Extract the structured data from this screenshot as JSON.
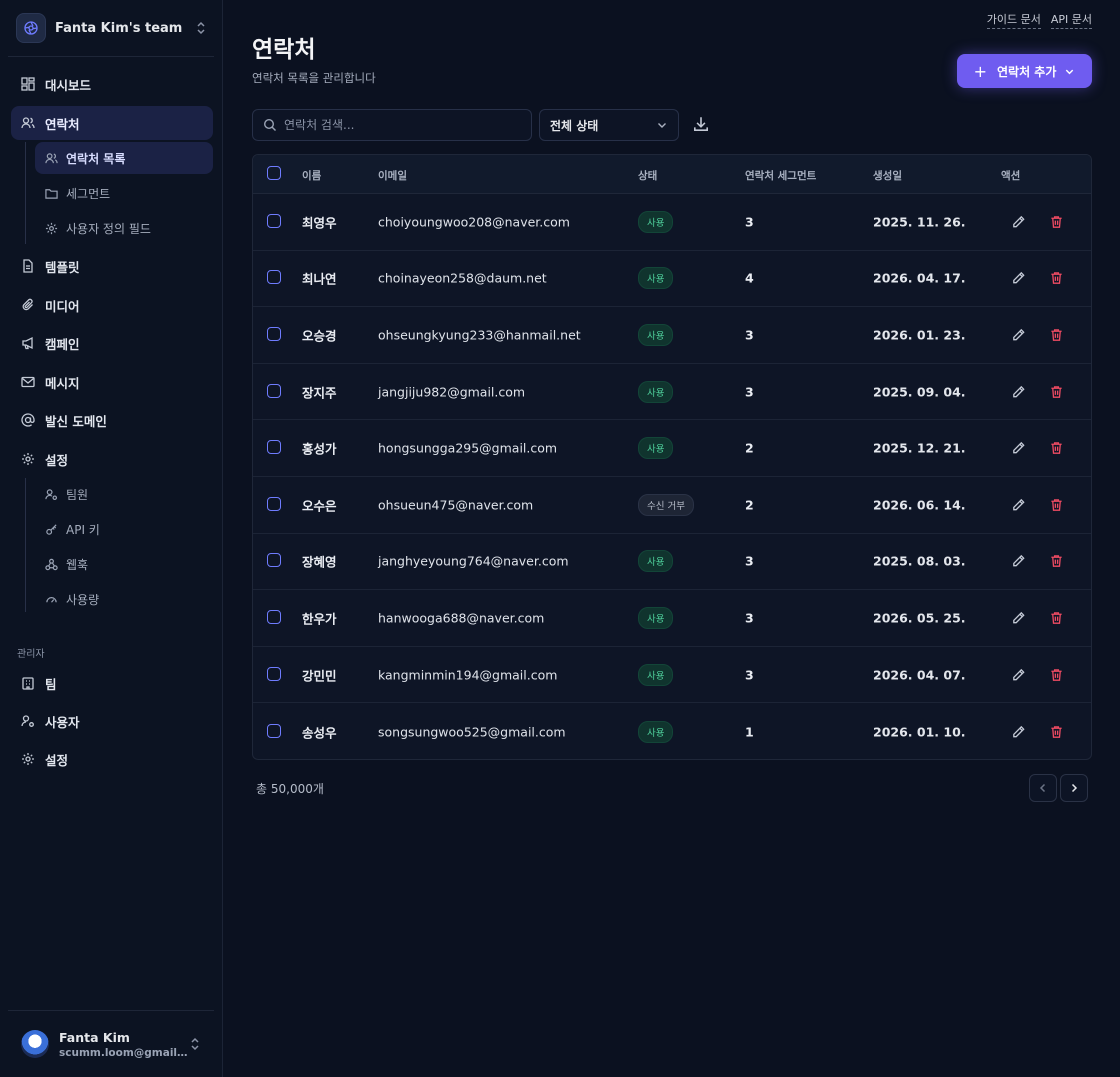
{
  "team": {
    "name": "Fanta Kim's team"
  },
  "nav": {
    "dashboard": "대시보드",
    "contacts": "연락처",
    "contacts_list": "연락처 목록",
    "segments": "세그먼트",
    "custom_fields": "사용자 정의 필드",
    "templates": "템플릿",
    "media": "미디어",
    "campaigns": "캠페인",
    "messages": "메시지",
    "sending_domains": "발신 도메인",
    "settings": "설정",
    "team_members": "팀원",
    "api_keys": "API 키",
    "webhooks": "웹훅",
    "usage": "사용량"
  },
  "admin": {
    "section_label": "관리자",
    "teams": "팀",
    "users": "사용자",
    "settings": "설정"
  },
  "user": {
    "name": "Fanta Kim",
    "email": "scumm.loom@gmail.c..."
  },
  "top_links": {
    "guide": "가이드 문서",
    "api": "API 문서"
  },
  "page": {
    "title": "연락처",
    "subtitle": "연락처 목록을 관리합니다"
  },
  "add_button": {
    "label": "연락처 추가"
  },
  "search": {
    "placeholder": "연락처 검색..."
  },
  "status_filter": {
    "value": "전체 상태"
  },
  "table": {
    "headers": {
      "name": "이름",
      "email": "이메일",
      "status": "상태",
      "segments": "연락처 세그먼트",
      "created": "생성일",
      "actions": "액션"
    },
    "rows": [
      {
        "name": "최영우",
        "email": "choiyoungwoo208@naver.com",
        "status": "사용",
        "status_type": "active",
        "segments": "3",
        "created": "2025. 11. 26."
      },
      {
        "name": "최나연",
        "email": "choinayeon258@daum.net",
        "status": "사용",
        "status_type": "active",
        "segments": "4",
        "created": "2026. 04. 17."
      },
      {
        "name": "오승경",
        "email": "ohseungkyung233@hanmail.net",
        "status": "사용",
        "status_type": "active",
        "segments": "3",
        "created": "2026. 01. 23."
      },
      {
        "name": "장지주",
        "email": "jangjiju982@gmail.com",
        "status": "사용",
        "status_type": "active",
        "segments": "3",
        "created": "2025. 09. 04."
      },
      {
        "name": "홍성가",
        "email": "hongsungga295@gmail.com",
        "status": "사용",
        "status_type": "active",
        "segments": "2",
        "created": "2025. 12. 21."
      },
      {
        "name": "오수은",
        "email": "ohsueun475@naver.com",
        "status": "수신 거부",
        "status_type": "unsubscribed",
        "segments": "2",
        "created": "2026. 06. 14."
      },
      {
        "name": "장혜영",
        "email": "janghyeyoung764@naver.com",
        "status": "사용",
        "status_type": "active",
        "segments": "3",
        "created": "2025. 08. 03."
      },
      {
        "name": "한우가",
        "email": "hanwooga688@naver.com",
        "status": "사용",
        "status_type": "active",
        "segments": "3",
        "created": "2026. 05. 25."
      },
      {
        "name": "강민민",
        "email": "kangminmin194@gmail.com",
        "status": "사용",
        "status_type": "active",
        "segments": "3",
        "created": "2026. 04. 07."
      },
      {
        "name": "송성우",
        "email": "songsungwoo525@gmail.com",
        "status": "사용",
        "status_type": "active",
        "segments": "1",
        "created": "2026. 01. 10."
      }
    ]
  },
  "footer": {
    "total": "총 50,000개"
  },
  "colors": {
    "accent": "#6f5cf0",
    "active_badge": "#4fd19c",
    "danger": "#ef4b63",
    "background": "#0b1120"
  },
  "icons": {
    "team": "aperture-icon",
    "dashboard": "grid-icon",
    "contacts": "users-icon",
    "folder": "folder-icon",
    "gear": "gear-icon",
    "file": "file-icon",
    "paperclip": "paperclip-icon",
    "megaphone": "megaphone-icon",
    "mail": "mail-icon",
    "at": "at-icon",
    "user": "user-icon",
    "key": "key-icon",
    "webhook": "webhook-icon",
    "gauge": "gauge-icon",
    "building": "building-icon",
    "search": "search-icon",
    "download": "download-icon",
    "edit": "pencil-icon",
    "delete": "trash-icon"
  }
}
